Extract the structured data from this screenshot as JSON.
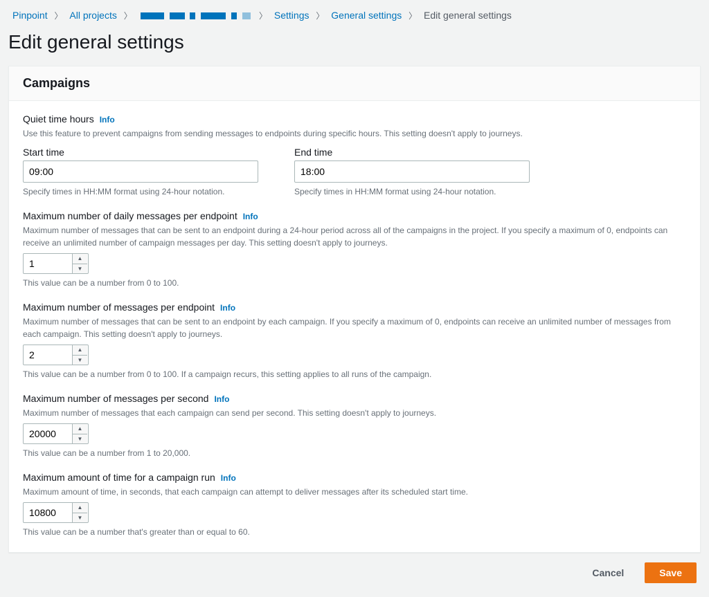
{
  "breadcrumbs": {
    "pinpoint": "Pinpoint",
    "all_projects": "All projects",
    "settings": "Settings",
    "general_settings": "General settings",
    "current": "Edit general settings"
  },
  "page_title": "Edit general settings",
  "panel_header": "Campaigns",
  "quiet_time": {
    "label": "Quiet time hours",
    "info": "Info",
    "desc": "Use this feature to prevent campaigns from sending messages to endpoints during specific hours. This setting doesn't apply to journeys.",
    "start_label": "Start time",
    "start_value": "09:00",
    "start_hint": "Specify times in HH:MM format using 24-hour notation.",
    "end_label": "End time",
    "end_value": "18:00",
    "end_hint": "Specify times in HH:MM format using 24-hour notation."
  },
  "daily_max": {
    "label": "Maximum number of daily messages per endpoint",
    "info": "Info",
    "desc": "Maximum number of messages that can be sent to an endpoint during a 24-hour period across all of the campaigns in the project. If you specify a maximum of 0, endpoints can receive an unlimited number of campaign messages per day. This setting doesn't apply to journeys.",
    "value": "1",
    "hint": "This value can be a number from 0 to 100."
  },
  "per_endpoint": {
    "label": "Maximum number of messages per endpoint",
    "info": "Info",
    "desc": "Maximum number of messages that can be sent to an endpoint by each campaign. If you specify a maximum of 0, endpoints can receive an unlimited number of messages from each campaign. This setting doesn't apply to journeys.",
    "value": "2",
    "hint": "This value can be a number from 0 to 100. If a campaign recurs, this setting applies to all runs of the campaign."
  },
  "per_second": {
    "label": "Maximum number of messages per second",
    "info": "Info",
    "desc": "Maximum number of messages that each campaign can send per second. This setting doesn't apply to journeys.",
    "value": "20000",
    "hint": "This value can be a number from 1 to 20,000."
  },
  "campaign_time": {
    "label": "Maximum amount of time for a campaign run",
    "info": "Info",
    "desc": "Maximum amount of time, in seconds, that each campaign can attempt to deliver messages after its scheduled start time.",
    "value": "10800",
    "hint": "This value can be a number that's greater than or equal to 60."
  },
  "actions": {
    "cancel": "Cancel",
    "save": "Save"
  }
}
